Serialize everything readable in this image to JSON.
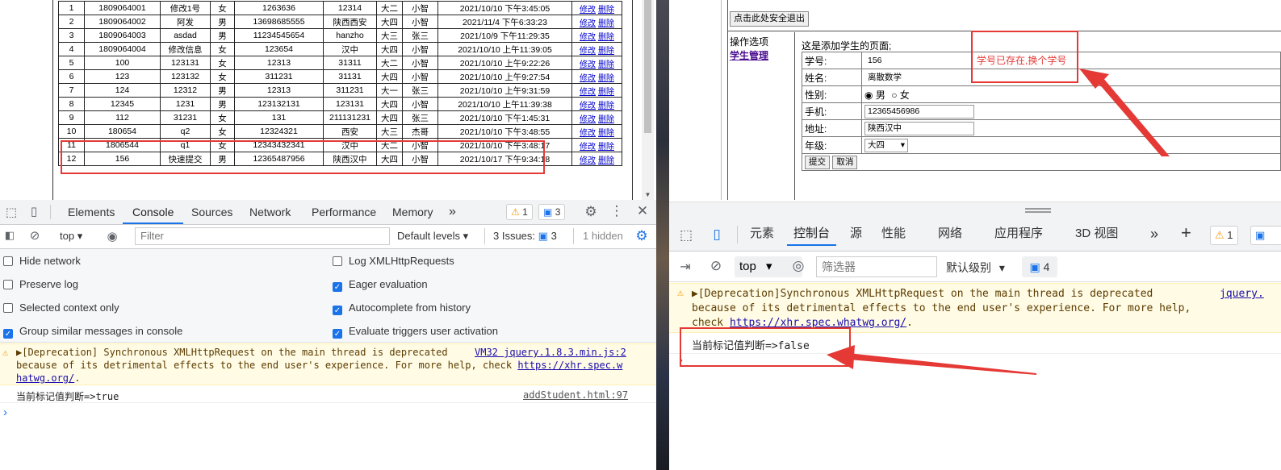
{
  "students": {
    "rows": [
      [
        "1",
        "1809064001",
        "修改1号",
        "女",
        "1263636",
        "12314",
        "大二",
        "小智",
        "2021/10/10 下午3:45:05"
      ],
      [
        "2",
        "1809064002",
        "阿发",
        "男",
        "13698685555",
        "陕西西安",
        "大四",
        "小智",
        "2021/11/4 下午6:33:23"
      ],
      [
        "3",
        "1809064003",
        "asdad",
        "男",
        "11234545654",
        "hanzho",
        "大三",
        "张三",
        "2021/10/9 下午11:29:35"
      ],
      [
        "4",
        "1809064004",
        "修改信息",
        "女",
        "123654",
        "汉中",
        "大四",
        "小智",
        "2021/10/10 上午11:39:05"
      ],
      [
        "5",
        "100",
        "123131",
        "女",
        "12313",
        "31311",
        "大二",
        "小智",
        "2021/10/10 上午9:22:26"
      ],
      [
        "6",
        "123",
        "123132",
        "女",
        "311231",
        "31131",
        "大四",
        "小智",
        "2021/10/10 上午9:27:54"
      ],
      [
        "7",
        "124",
        "12312",
        "男",
        "12313",
        "311231",
        "大一",
        "张三",
        "2021/10/10 上午9:31:59"
      ],
      [
        "8",
        "12345",
        "1231",
        "男",
        "123132131",
        "123131",
        "大四",
        "小智",
        "2021/10/10 上午11:39:38"
      ],
      [
        "9",
        "112",
        "31231",
        "女",
        "131",
        "211131231",
        "大四",
        "张三",
        "2021/10/10 下午1:45:31"
      ],
      [
        "10",
        "180654",
        "q2",
        "女",
        "12324321",
        "西安",
        "大三",
        "杰哥",
        "2021/10/10 下午3:48:55"
      ],
      [
        "11",
        "1806544",
        "q1",
        "女",
        "12343432341",
        "汉中",
        "大二",
        "小智",
        "2021/10/10 下午3:48:17"
      ],
      [
        "12",
        "156",
        "快速提交",
        "男",
        "12365487956",
        "陕西汉中",
        "大四",
        "小智",
        "2021/10/17 下午9:34:18"
      ]
    ],
    "edit_label": "修改",
    "delete_label": "删除"
  },
  "devtools_left": {
    "tabs": [
      "Elements",
      "Console",
      "Sources",
      "Network",
      "Performance",
      "Memory"
    ],
    "more_tabs": "»",
    "warn_count": "1",
    "msg_count": "3",
    "context": "top",
    "filter_placeholder": "Filter",
    "levels": "Default levels",
    "issues_label": "3 Issues:",
    "issues_count": "3",
    "hidden": "1 hidden",
    "settings": {
      "hide_network": "Hide network",
      "preserve_log": "Preserve log",
      "selected_context": "Selected context only",
      "group_similar": "Group similar messages in console",
      "log_xhr": "Log XMLHttpRequests",
      "eager_eval": "Eager evaluation",
      "autocomplete": "Autocomplete from history",
      "eval_triggers": "Evaluate triggers user activation"
    },
    "warning": {
      "line1": "▶[Deprecation] Synchronous XMLHttpRequest on the main thread is deprecated",
      "line2": "because of its detrimental effects to the end user's experience. For more help, check",
      "link1": "https://xhr.spec.w",
      "link2": "hatwg.org/",
      "source": "VM32 jquery.1.8.3.min.js:2"
    },
    "log": {
      "text": "当前标记值判断=>true",
      "source": "addStudent.html:97"
    },
    "prompt": "›"
  },
  "right_page": {
    "logout": "点击此处安全退出",
    "menu_title": "操作选项",
    "menu_link": "学生管理",
    "page_heading": "这是添加学生的页面;",
    "labels": {
      "sid": "学号:",
      "name": "姓名:",
      "gender": "性别:",
      "phone": "手机:",
      "address": "地址:",
      "grade": "年级:"
    },
    "values": {
      "sid": "156",
      "name": "离散数学",
      "male": "男",
      "female": "女",
      "phone": "12365456986",
      "address": "陕西汉中",
      "grade": "大四"
    },
    "error": "学号已存在,换个学号",
    "submit": "提交",
    "cancel": "取消"
  },
  "devtools_right": {
    "tabs": [
      "元素",
      "控制台",
      "源",
      "性能",
      "网络",
      "应用程序",
      "3D 视图"
    ],
    "more": "»",
    "plus": "+",
    "warn_count": "1",
    "context": "top",
    "filter_placeholder": "筛选器",
    "levels": "默认级别",
    "msg_count": "4",
    "warning": {
      "line1": "▶[Deprecation]Synchronous XMLHttpRequest on the main thread is deprecated",
      "line2": "because of its detrimental effects to the end user's experience. For more help,",
      "line3_prefix": "check ",
      "link": "https://xhr.spec.whatwg.org/",
      "source": "jquery."
    },
    "log": {
      "text": "当前标记值判断=>false"
    },
    "prompt": "›"
  },
  "colors": {
    "annotation_red": "#e53935",
    "devtools_blue": "#1a73e8",
    "warning_bg": "#fffbe5"
  }
}
